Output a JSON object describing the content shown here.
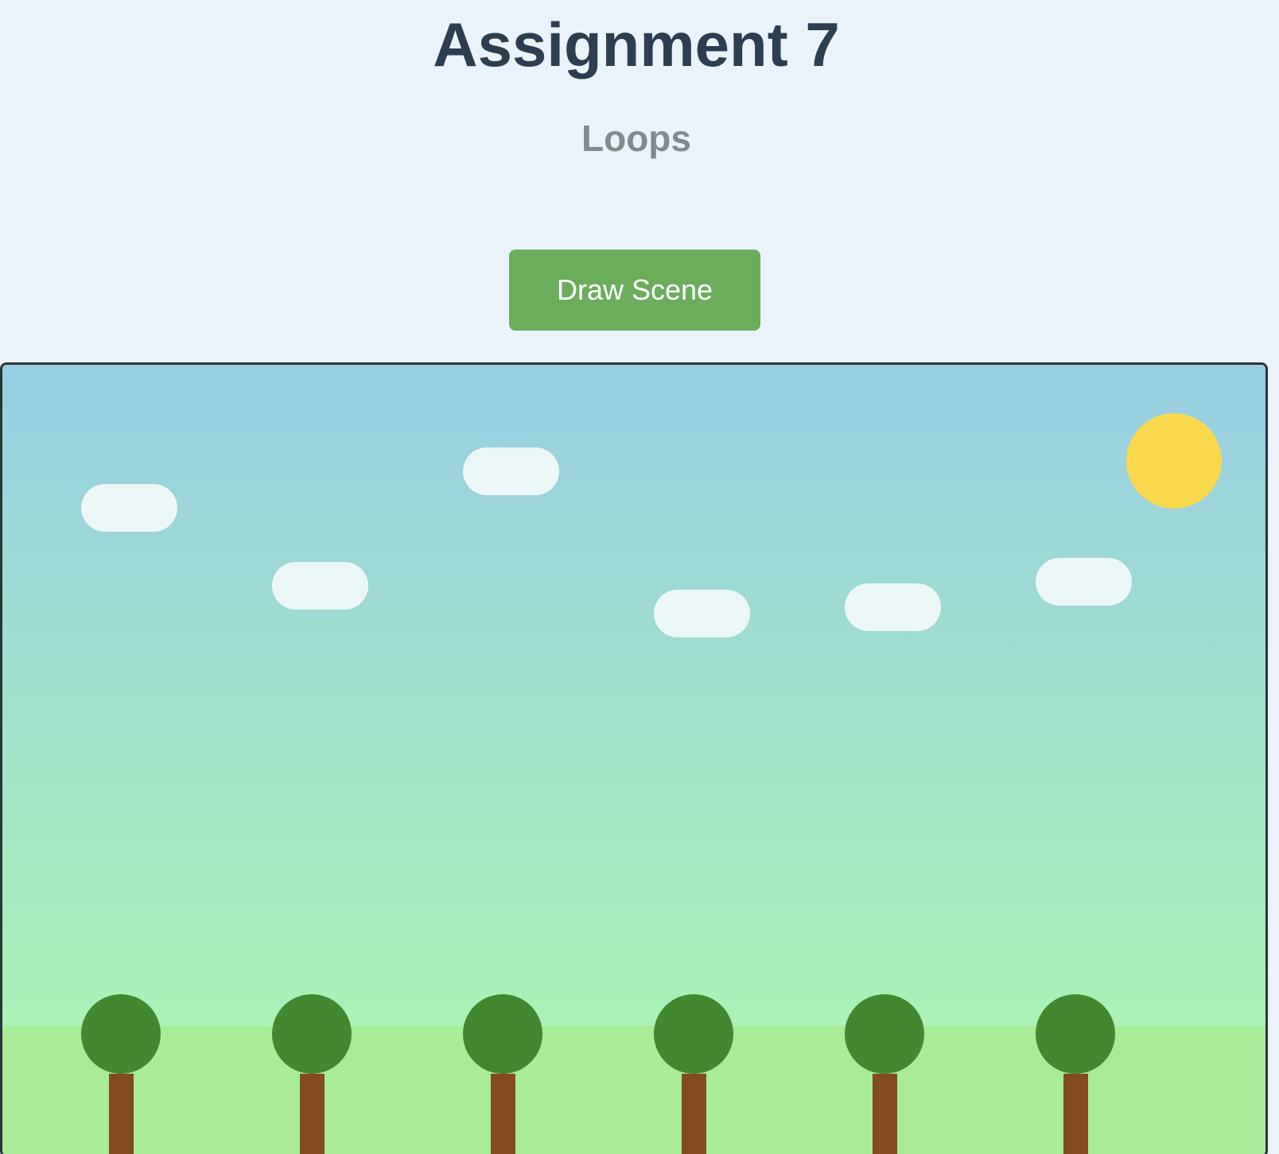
{
  "header": {
    "title": "Assignment 7",
    "subtitle": "Loops"
  },
  "controls": {
    "draw_label": "Draw Scene"
  },
  "scene": {
    "colors": {
      "sky_top": "#97cde4",
      "sky_bottom": "#aaf2b5",
      "ground": "#a8ec98",
      "sun": "#f9d84c",
      "cloud": "#ebf7f6",
      "foliage": "#438731",
      "trunk": "#834a23"
    },
    "counts": {
      "clouds": 6,
      "trees": 6
    },
    "sun_present": true
  }
}
